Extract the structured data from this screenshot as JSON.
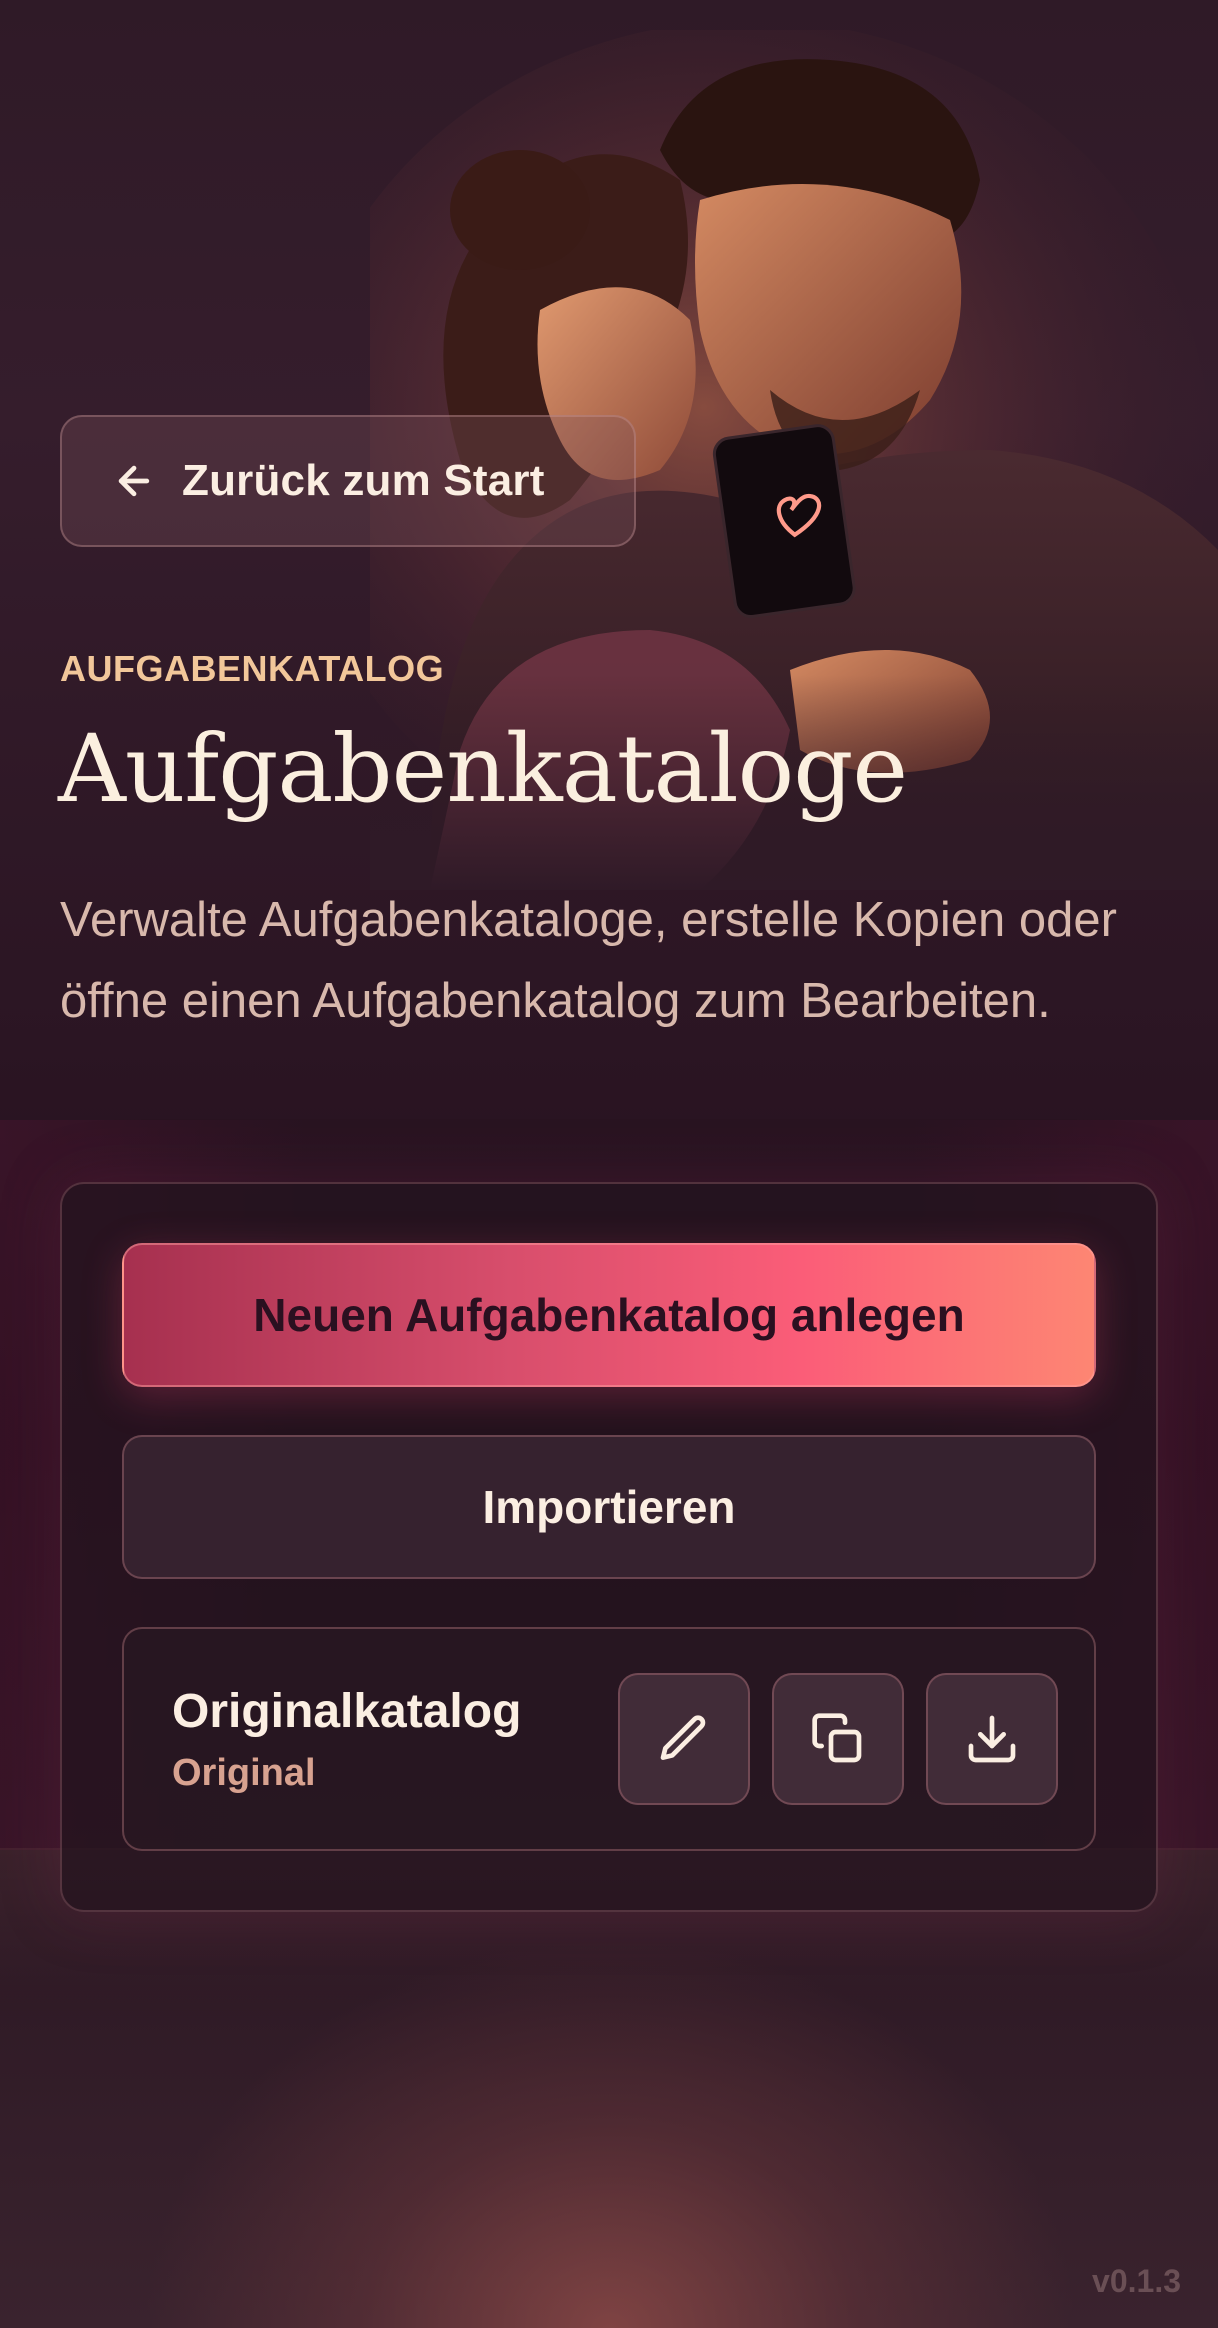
{
  "header": {
    "back_label": "Zurück zum Start",
    "eyebrow": "AUFGABENKATALOG",
    "title": "Aufgabenkataloge",
    "description": "Verwalte Aufgabenkataloge, erstelle Kopien oder öffne einen Aufgabenkatalog zum Bearbeiten."
  },
  "actions": {
    "create_label": "Neuen Aufgabenkatalog anlegen",
    "import_label": "Importieren"
  },
  "catalogs": [
    {
      "name": "Originalkatalog",
      "type": "Original",
      "actions": [
        "edit-icon",
        "copy-icon",
        "download-icon"
      ]
    }
  ],
  "footer": {
    "version": "v0.1.3"
  },
  "colors": {
    "accent_start": "#a6304f",
    "accent_mid": "#fb5d78",
    "accent_end": "#fd8673",
    "eyebrow": "#f2c79a",
    "background": "#2a1621"
  }
}
